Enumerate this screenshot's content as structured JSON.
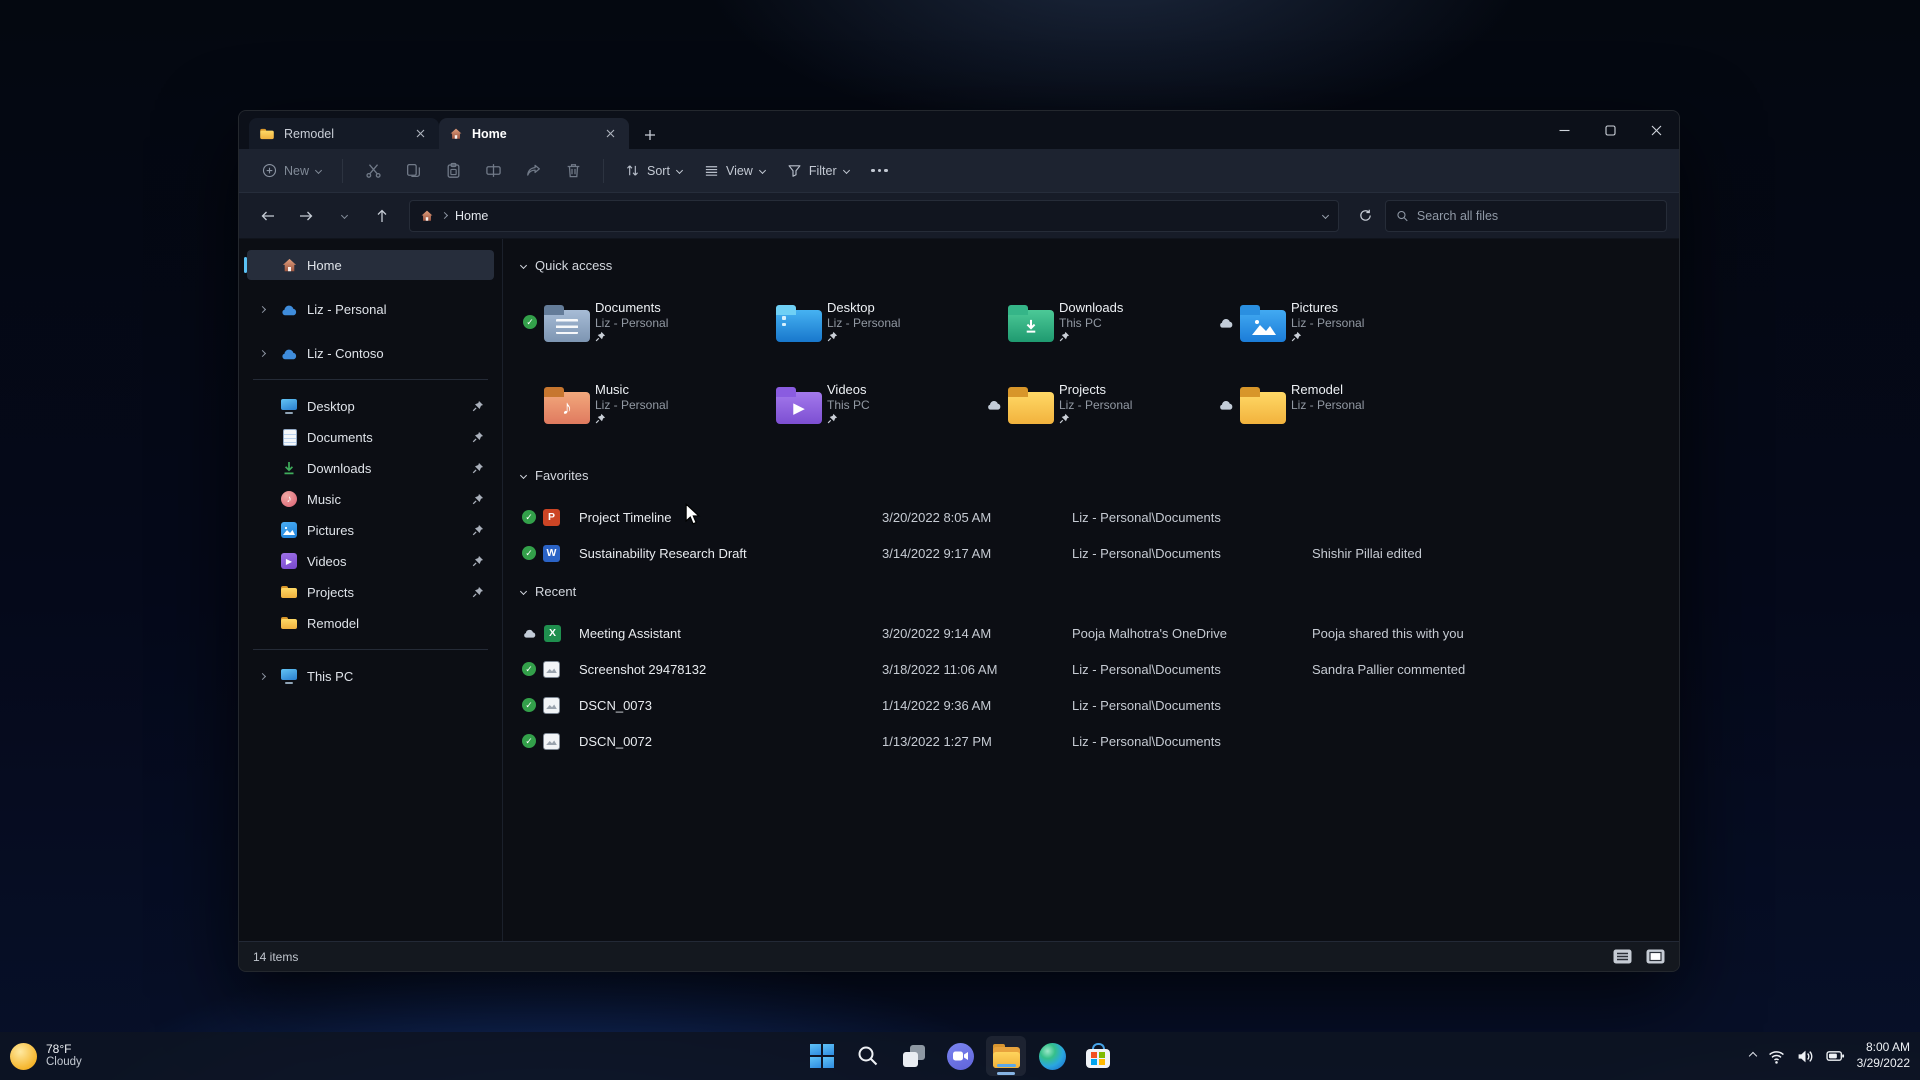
{
  "window": {
    "tabs": [
      {
        "label": "Remodel"
      },
      {
        "label": "Home"
      }
    ],
    "toolbar": {
      "new": "New",
      "sort": "Sort",
      "view": "View",
      "filter": "Filter"
    },
    "address": {
      "breadcrumb_root": "Home",
      "search_placeholder": "Search all files"
    },
    "sidebar": {
      "home": "Home",
      "accounts": [
        "Liz - Personal",
        "Liz - Contoso"
      ],
      "pinned": [
        {
          "label": "Desktop"
        },
        {
          "label": "Documents"
        },
        {
          "label": "Downloads"
        },
        {
          "label": "Music"
        },
        {
          "label": "Pictures"
        },
        {
          "label": "Videos"
        },
        {
          "label": "Projects"
        },
        {
          "label": "Remodel"
        }
      ],
      "this_pc": "This PC"
    },
    "content": {
      "quick_access": {
        "title": "Quick access",
        "tiles": [
          {
            "name": "Documents",
            "location": "Liz - Personal"
          },
          {
            "name": "Desktop",
            "location": "Liz - Personal"
          },
          {
            "name": "Downloads",
            "location": "This PC"
          },
          {
            "name": "Pictures",
            "location": "Liz - Personal"
          },
          {
            "name": "Music",
            "location": "Liz - Personal"
          },
          {
            "name": "Videos",
            "location": "This PC"
          },
          {
            "name": "Projects",
            "location": "Liz - Personal"
          },
          {
            "name": "Remodel",
            "location": "Liz - Personal"
          }
        ]
      },
      "favorites": {
        "title": "Favorites",
        "rows": [
          {
            "name": "Project Timeline",
            "date": "3/20/2022 8:05 AM",
            "location": "Liz - Personal\\Documents",
            "note": ""
          },
          {
            "name": "Sustainability Research Draft",
            "date": "3/14/2022 9:17 AM",
            "location": "Liz - Personal\\Documents",
            "note": "Shishir Pillai edited"
          }
        ]
      },
      "recent": {
        "title": "Recent",
        "rows": [
          {
            "name": "Meeting Assistant",
            "date": "3/20/2022 9:14 AM",
            "location": "Pooja Malhotra's OneDrive",
            "note": "Pooja shared this with you"
          },
          {
            "name": "Screenshot 29478132",
            "date": "3/18/2022 11:06 AM",
            "location": "Liz - Personal\\Documents",
            "note": "Sandra Pallier commented"
          },
          {
            "name": "DSCN_0073",
            "date": "1/14/2022 9:36 AM",
            "location": "Liz - Personal\\Documents",
            "note": ""
          },
          {
            "name": "DSCN_0072",
            "date": "1/13/2022 1:27 PM",
            "location": "Liz - Personal\\Documents",
            "note": ""
          }
        ]
      }
    },
    "statusbar": {
      "count": "14 items"
    }
  },
  "taskbar": {
    "weather": {
      "temp": "78°F",
      "condition": "Cloudy"
    },
    "tray": {
      "time": "8:00 AM",
      "date": "3/29/2022"
    }
  },
  "colors": {
    "accent": "#5ac2f5",
    "sync_green": "#33a04a",
    "folder_yellow": "#f2b23d"
  },
  "icons": {
    "music_note": "♪",
    "play": "▶",
    "check": "✓"
  }
}
